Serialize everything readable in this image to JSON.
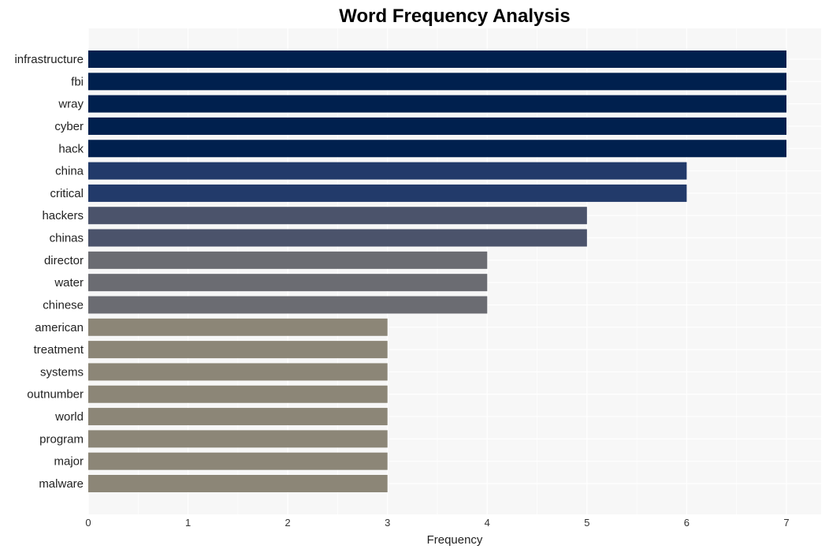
{
  "chart_data": {
    "type": "bar",
    "orientation": "horizontal",
    "title": "Word Frequency Analysis",
    "xlabel": "Frequency",
    "ylabel": "",
    "xlim": [
      0,
      7.35
    ],
    "xticks": [
      0,
      1,
      2,
      3,
      4,
      5,
      6,
      7
    ],
    "grid": true,
    "legend": "none",
    "categories": [
      "infrastructure",
      "fbi",
      "wray",
      "cyber",
      "hack",
      "china",
      "critical",
      "hackers",
      "chinas",
      "director",
      "water",
      "chinese",
      "american",
      "treatment",
      "systems",
      "outnumber",
      "world",
      "program",
      "major",
      "malware"
    ],
    "values": [
      7,
      7,
      7,
      7,
      7,
      6,
      6,
      5,
      5,
      4,
      4,
      4,
      3,
      3,
      3,
      3,
      3,
      3,
      3,
      3
    ],
    "color_by_value": {
      "7": "#00204e",
      "6": "#223a6a",
      "5": "#4b536b",
      "4": "#6b6c72",
      "3": "#8c8677"
    }
  },
  "colors": {
    "panel_background": "#f7f7f7",
    "grid": "#ffffff",
    "title": "#000000"
  }
}
